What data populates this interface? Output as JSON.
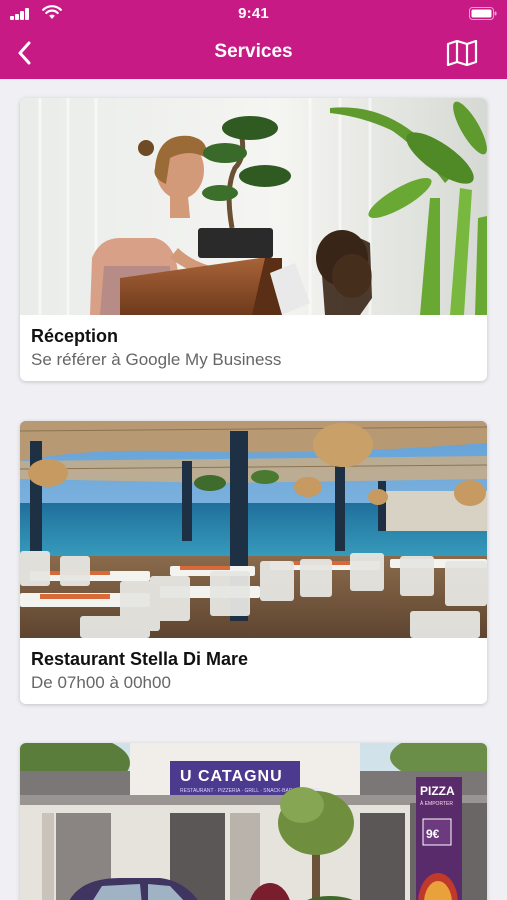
{
  "status_bar": {
    "time": "9:41"
  },
  "navbar": {
    "title": "Services"
  },
  "services": [
    {
      "title": "Réception",
      "subtitle": "Se référer à Google My Business"
    },
    {
      "title": "Restaurant Stella Di Mare",
      "subtitle": "De 07h00 à 00h00"
    },
    {
      "title": "",
      "subtitle": ""
    }
  ],
  "photo_text": {
    "sign": "U CATAGNU",
    "sign_sub": "RESTAURANT · PIZZERIA · GRILL · SNACK-BAR · GLACIER",
    "pizza": "PIZZA",
    "pizza_sub": "À EMPORTER",
    "price": "9€"
  },
  "colors": {
    "brand": "#c81a85",
    "background": "#efeff4"
  }
}
